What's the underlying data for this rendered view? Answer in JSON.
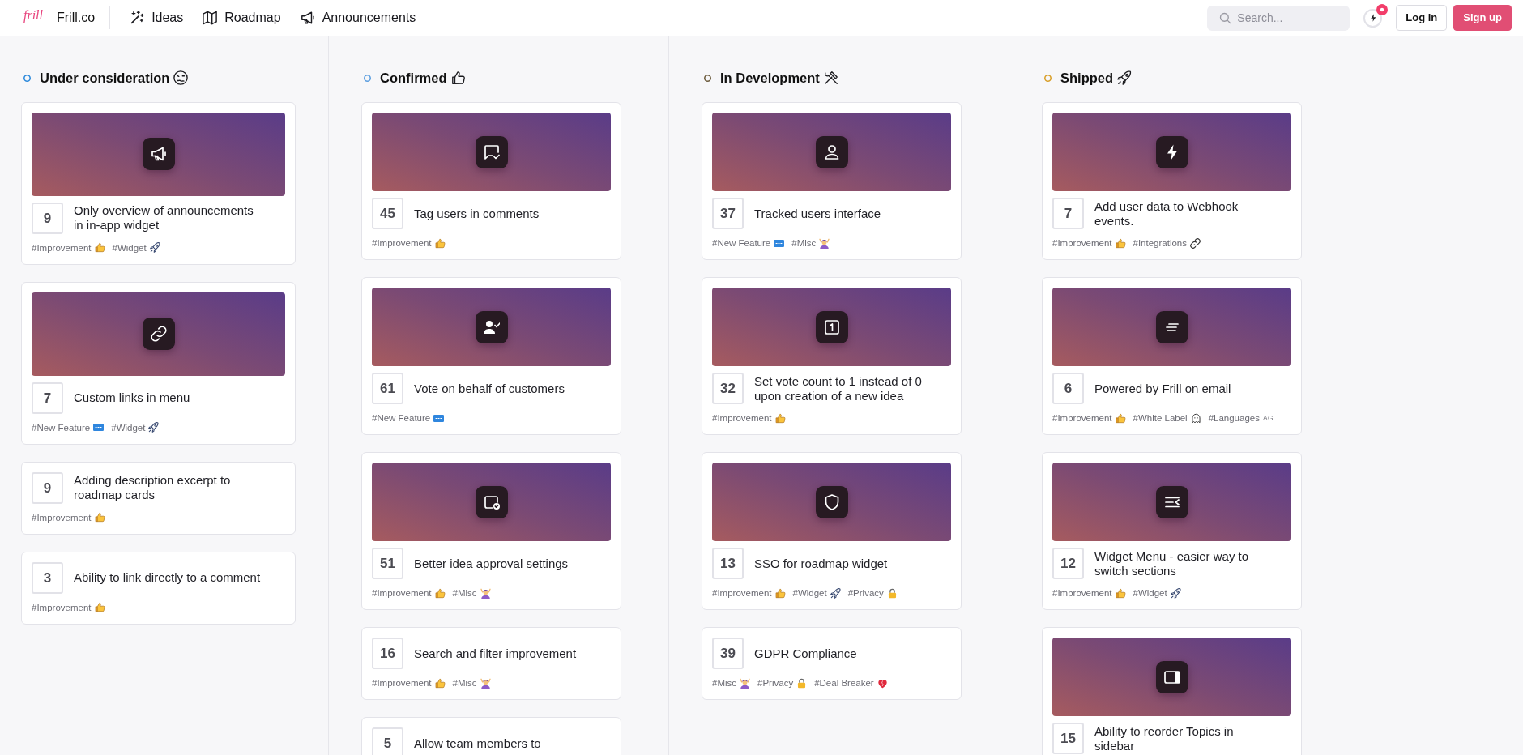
{
  "header": {
    "logo": "frill",
    "brand": "Frill.co",
    "nav": [
      {
        "label": "Ideas",
        "kind": "wand"
      },
      {
        "label": "Roadmap",
        "kind": "map"
      },
      {
        "label": "Announcements",
        "kind": "megaphone"
      }
    ],
    "search": {
      "placeholder": "Search..."
    },
    "alerts": {
      "unread": true
    },
    "buttons": [
      {
        "label": "Log in",
        "kind": "outline"
      },
      {
        "label": "Sign up",
        "kind": "primary"
      }
    ]
  },
  "columns": [
    {
      "title": "Under consideration",
      "kind": "woozy",
      "color": "#2f8bdc",
      "cards": [
        {
          "kind": "megaphone",
          "votes": "9",
          "title": "Only overview of announcements in in-app widget",
          "tags": [
            {
              "label": "#Improvement",
              "kind": "thumbsup"
            },
            {
              "label": "#Widget",
              "kind": "rocket"
            }
          ]
        },
        {
          "kind": "chain",
          "votes": "7",
          "title": "Custom links in menu",
          "tags": [
            {
              "label": "#New Feature",
              "kind": "sign"
            },
            {
              "label": "#Widget",
              "kind": "rocket"
            }
          ]
        },
        {
          "kind": "plain",
          "votes": "9",
          "title": "Adding description excerpt to roadmap cards",
          "tags": [
            {
              "label": "#Improvement",
              "kind": "thumbsup"
            }
          ]
        },
        {
          "kind": "plain",
          "votes": "3",
          "title": "Ability to link directly to a comment",
          "tags": [
            {
              "label": "#Improvement",
              "kind": "thumbsup"
            }
          ]
        }
      ]
    },
    {
      "title": "Confirmed",
      "kind": "thumbsup",
      "color": "#5d9fe0",
      "cards": [
        {
          "kind": "bubble",
          "votes": "45",
          "title": "Tag users in comments",
          "tags": [
            {
              "label": "#Improvement",
              "kind": "thumbsup"
            }
          ]
        },
        {
          "kind": "usercheck",
          "votes": "61",
          "title": "Vote on behalf of customers",
          "tags": [
            {
              "label": "#New Feature",
              "kind": "sign"
            }
          ]
        },
        {
          "kind": "squarecheck",
          "votes": "51",
          "title": "Better idea approval settings",
          "tags": [
            {
              "label": "#Improvement",
              "kind": "thumbsup"
            },
            {
              "label": "#Misc",
              "kind": "person"
            }
          ]
        },
        {
          "kind": "plain",
          "votes": "16",
          "title": "Search and filter improvement",
          "tags": [
            {
              "label": "#Improvement",
              "kind": "thumbsup"
            },
            {
              "label": "#Misc",
              "kind": "person"
            }
          ]
        },
        {
          "kind": "plain",
          "votes": "5",
          "title": "Allow team members to"
        }
      ]
    },
    {
      "title": "In Development",
      "kind": "tools",
      "color": "#6e5d3f",
      "cards": [
        {
          "kind": "user",
          "votes": "37",
          "title": "Tracked users interface",
          "tags": [
            {
              "label": "#New Feature",
              "kind": "sign"
            },
            {
              "label": "#Misc",
              "kind": "person"
            }
          ]
        },
        {
          "kind": "digit",
          "votes": "32",
          "title": "Set vote count to 1 instead of 0 upon creation of a new idea",
          "tags": [
            {
              "label": "#Improvement",
              "kind": "thumbsup"
            }
          ]
        },
        {
          "kind": "shield",
          "votes": "13",
          "title": "SSO for roadmap widget",
          "tags": [
            {
              "label": "#Improvement",
              "kind": "thumbsup"
            },
            {
              "label": "#Widget",
              "kind": "rocket"
            },
            {
              "label": "#Privacy",
              "kind": "lock"
            }
          ]
        },
        {
          "kind": "plain",
          "votes": "39",
          "title": "GDPR Compliance",
          "tags": [
            {
              "label": "#Misc",
              "kind": "person"
            },
            {
              "label": "#Privacy",
              "kind": "lock"
            },
            {
              "label": "#Deal Breaker",
              "kind": "heart"
            }
          ]
        }
      ]
    },
    {
      "title": "Shipped",
      "kind": "rocket",
      "color": "#d9a02c",
      "cards": [
        {
          "kind": "lightning",
          "votes": "7",
          "title": "Add user data to Webhook events.",
          "tags": [
            {
              "label": "#Improvement",
              "kind": "thumbsup"
            },
            {
              "label": "#Integrations",
              "kind": "chain"
            }
          ]
        },
        {
          "kind": "lines",
          "votes": "6",
          "title": "Powered by Frill on email",
          "tags": [
            {
              "label": "#Improvement",
              "kind": "thumbsup"
            },
            {
              "label": "#White Label",
              "kind": "ghost"
            },
            {
              "label": "#Languages",
              "code": "AG"
            }
          ]
        },
        {
          "kind": "collapse",
          "votes": "12",
          "title": "Widget Menu - easier way to switch sections",
          "tags": [
            {
              "label": "#Improvement",
              "kind": "thumbsup"
            },
            {
              "label": "#Widget",
              "kind": "rocket"
            }
          ]
        },
        {
          "kind": "panel",
          "votes": "15",
          "title": "Ability to reorder Topics in sidebar"
        }
      ]
    }
  ]
}
